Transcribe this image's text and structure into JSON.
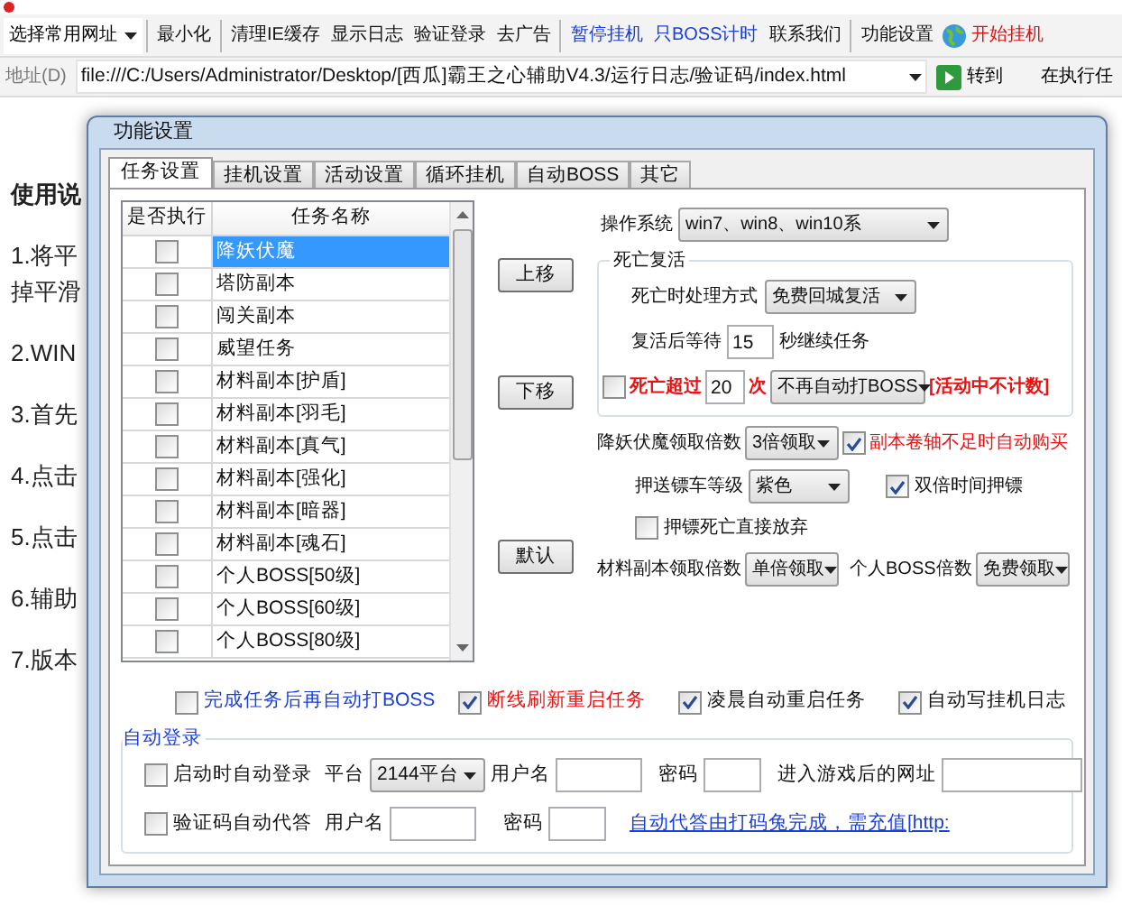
{
  "toolbar_groups": [
    [
      {
        "label": "选择常用网址",
        "kind": "dropdown"
      }
    ],
    [
      {
        "label": "最小化",
        "kind": "button"
      }
    ],
    [
      {
        "label": "清理IE缓存",
        "kind": "button"
      },
      {
        "label": "显示日志",
        "kind": "button"
      },
      {
        "label": "验证登录",
        "kind": "button"
      },
      {
        "label": "去广告",
        "kind": "button"
      }
    ],
    [
      {
        "label": "暂停挂机",
        "kind": "accent"
      },
      {
        "label": "只BOSS计时",
        "kind": "accent"
      },
      {
        "label": "联系我们",
        "kind": "button"
      }
    ],
    [
      {
        "label": "功能设置",
        "kind": "button"
      },
      {
        "label": "开始挂机",
        "kind": "start"
      }
    ]
  ],
  "address_bar": {
    "label": "地址(D)",
    "url": "file:///C:/Users/Administrator/Desktop/[西瓜]霸王之心辅助V4.3/运行日志/验证码/index.html",
    "go_button": "转到",
    "status": "在执行任"
  },
  "background_text": [
    {
      "kind": "heading",
      "text": "使用说"
    },
    {
      "kind": "step",
      "text": "1.将平"
    },
    {
      "kind": "continuation",
      "text": "掉平滑"
    },
    {
      "kind": "step",
      "text": "2.WIN"
    },
    {
      "kind": "step",
      "text": "3.首先"
    },
    {
      "kind": "step",
      "text": "4.点击"
    },
    {
      "kind": "step",
      "text": "5.点击"
    },
    {
      "kind": "step",
      "text": "6.辅助"
    },
    {
      "kind": "step",
      "text": "7.版本"
    }
  ],
  "dialog": {
    "title": "功能设置",
    "tabs": [
      {
        "label": "任务设置",
        "selected": true
      },
      {
        "label": "挂机设置",
        "selected": false
      },
      {
        "label": "活动设置",
        "selected": false
      },
      {
        "label": "循环挂机",
        "selected": false
      },
      {
        "label": "自动BOSS",
        "selected": false
      },
      {
        "label": "其它",
        "selected": false
      }
    ],
    "task_table": {
      "columns": [
        "是否执行",
        "任务名称"
      ],
      "rows": [
        {
          "name": "降妖伏魔",
          "checked": false,
          "selected": true
        },
        {
          "name": "塔防副本",
          "checked": false,
          "selected": false
        },
        {
          "name": "闯关副本",
          "checked": false,
          "selected": false
        },
        {
          "name": "威望任务",
          "checked": false,
          "selected": false
        },
        {
          "name": "材料副本[护盾]",
          "checked": false,
          "selected": false
        },
        {
          "name": "材料副本[羽毛]",
          "checked": false,
          "selected": false
        },
        {
          "name": "材料副本[真气]",
          "checked": false,
          "selected": false
        },
        {
          "name": "材料副本[强化]",
          "checked": false,
          "selected": false
        },
        {
          "name": "材料副本[暗器]",
          "checked": false,
          "selected": false
        },
        {
          "name": "材料副本[魂石]",
          "checked": false,
          "selected": false
        },
        {
          "name": "个人BOSS[50级]",
          "checked": false,
          "selected": false
        },
        {
          "name": "个人BOSS[60级]",
          "checked": false,
          "selected": false
        },
        {
          "name": "个人BOSS[80级]",
          "checked": false,
          "selected": false
        }
      ]
    },
    "side_buttons": [
      "上移",
      "下移",
      "默认"
    ],
    "os": {
      "label": "操作系统",
      "value": "win7、win8、win10系"
    },
    "death": {
      "title": "死亡复活",
      "mode_label": "死亡时处理方式",
      "mode_value": "免费回城复活",
      "wait_label": "复活后等待",
      "wait_value": "15",
      "wait_suffix": "秒继续任务",
      "limit_checked": false,
      "limit_label": "死亡超过",
      "limit_value": "20",
      "limit_suffix": "次",
      "limit_action": "不再自动打BOSS",
      "limit_note": "[活动中不计数]"
    },
    "demon": {
      "label": "降妖伏魔领取倍数",
      "value": "3倍领取",
      "auto_buy_checked": true,
      "auto_buy_label": "副本卷轴不足时自动购买"
    },
    "escort": {
      "label": "押送镖车等级",
      "value": "紫色",
      "double_checked": true,
      "double_label": "双倍时间押镖",
      "abandon_checked": false,
      "abandon_label": "押镖死亡直接放弃"
    },
    "material": {
      "label": "材料副本领取倍数",
      "value": "单倍领取",
      "boss_label": "个人BOSS倍数",
      "boss_value": "免费领取"
    },
    "options": [
      {
        "label": "完成任务后再自动打BOSS",
        "checked": false,
        "kind": "link"
      },
      {
        "label": "断线刷新重启任务",
        "checked": true,
        "kind": "warning"
      },
      {
        "label": "凌晨自动重启任务",
        "checked": true,
        "kind": "normal"
      },
      {
        "label": "自动写挂机日志",
        "checked": true,
        "kind": "normal"
      }
    ],
    "auto_login": {
      "title": "自动登录",
      "login_checked": false,
      "login_label": "启动时自动登录",
      "platform_label": "平台",
      "platform_value": "2144平台",
      "user_label": "用户名",
      "password_label": "密码",
      "url_label": "进入游戏后的网址",
      "captcha_checked": false,
      "captcha_label": "验证码自动代答",
      "captcha_user_label": "用户名",
      "captcha_password_label": "密码",
      "captcha_link": "自动代答由打码兔完成，需充值[http:"
    }
  }
}
